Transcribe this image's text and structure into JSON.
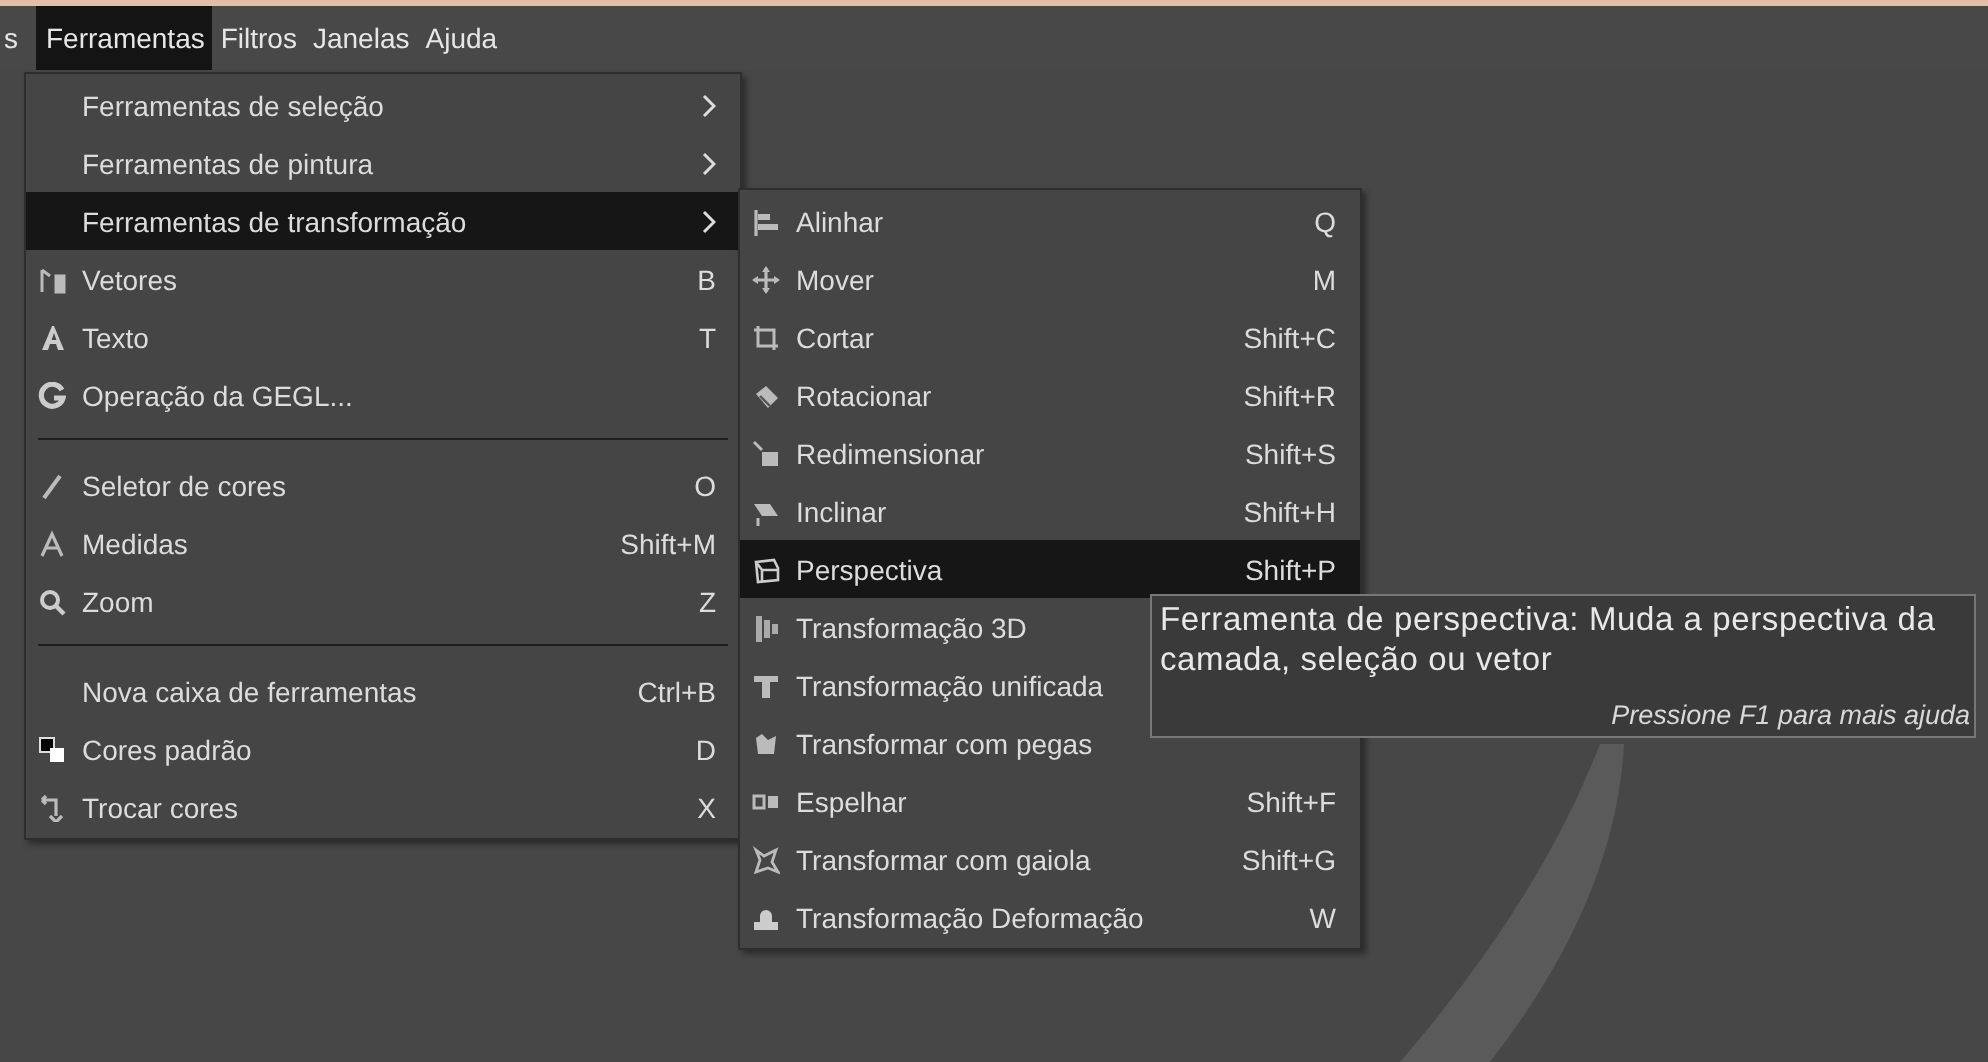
{
  "menubar": [
    {
      "label": "s",
      "selected": false
    },
    {
      "label": "Ferramentas",
      "selected": true
    },
    {
      "label": "Filtros",
      "selected": false
    },
    {
      "label": "Janelas",
      "selected": false
    },
    {
      "label": "Ajuda",
      "selected": false
    }
  ],
  "menu": {
    "items": [
      {
        "kind": "item",
        "label": "Ferramentas de seleção",
        "submenu": true,
        "selected": false
      },
      {
        "kind": "item",
        "label": "Ferramentas de pintura",
        "submenu": true,
        "selected": false
      },
      {
        "kind": "item",
        "label": "Ferramentas de transformação",
        "submenu": true,
        "selected": true
      },
      {
        "kind": "item",
        "label": "Vetores",
        "shortcut": "B",
        "submenu": false,
        "selected": false
      },
      {
        "kind": "item",
        "label": "Texto",
        "shortcut": "T",
        "submenu": false,
        "selected": false
      },
      {
        "kind": "item",
        "label": "Operação da GEGL...",
        "submenu": false,
        "selected": false
      },
      {
        "kind": "separator"
      },
      {
        "kind": "item",
        "label": "Seletor de cores",
        "shortcut": "O",
        "submenu": false,
        "selected": false
      },
      {
        "kind": "item",
        "label": "Medidas",
        "shortcut": "Shift+M",
        "submenu": false,
        "selected": false
      },
      {
        "kind": "item",
        "label": "Zoom",
        "shortcut": "Z",
        "submenu": false,
        "selected": false
      },
      {
        "kind": "separator"
      },
      {
        "kind": "item",
        "label": "Nova caixa de ferramentas",
        "shortcut": "Ctrl+B",
        "submenu": false,
        "selected": false
      },
      {
        "kind": "item",
        "label": "Cores padrão",
        "shortcut": "D",
        "submenu": false,
        "selected": false
      },
      {
        "kind": "item",
        "label": "Trocar cores",
        "shortcut": "X",
        "submenu": false,
        "selected": false
      }
    ]
  },
  "submenu": {
    "items": [
      {
        "label": "Alinhar",
        "shortcut": "Q",
        "selected": false
      },
      {
        "label": "Mover",
        "shortcut": "M",
        "selected": false
      },
      {
        "label": "Cortar",
        "shortcut": "Shift+C",
        "selected": false
      },
      {
        "label": "Rotacionar",
        "shortcut": "Shift+R",
        "selected": false
      },
      {
        "label": "Redimensionar",
        "shortcut": "Shift+S",
        "selected": false
      },
      {
        "label": "Inclinar",
        "shortcut": "Shift+H",
        "selected": false
      },
      {
        "label": "Perspectiva",
        "shortcut": "Shift+P",
        "selected": true
      },
      {
        "label": "Transformação 3D",
        "selected": false
      },
      {
        "label": "Transformação unificada",
        "selected": false
      },
      {
        "label": "Transformar com pegas",
        "selected": false
      },
      {
        "label": "Espelhar",
        "shortcut": "Shift+F",
        "selected": false
      },
      {
        "label": "Transformar com gaiola",
        "shortcut": "Shift+G",
        "selected": false
      },
      {
        "label": "Transformação Deformação",
        "shortcut": "W",
        "selected": false
      }
    ]
  },
  "tooltip": {
    "text": "Ferramenta de perspectiva: Muda a perspectiva da camada, seleção ou vetor",
    "hint": "Pressione F1 para mais ajuda"
  }
}
